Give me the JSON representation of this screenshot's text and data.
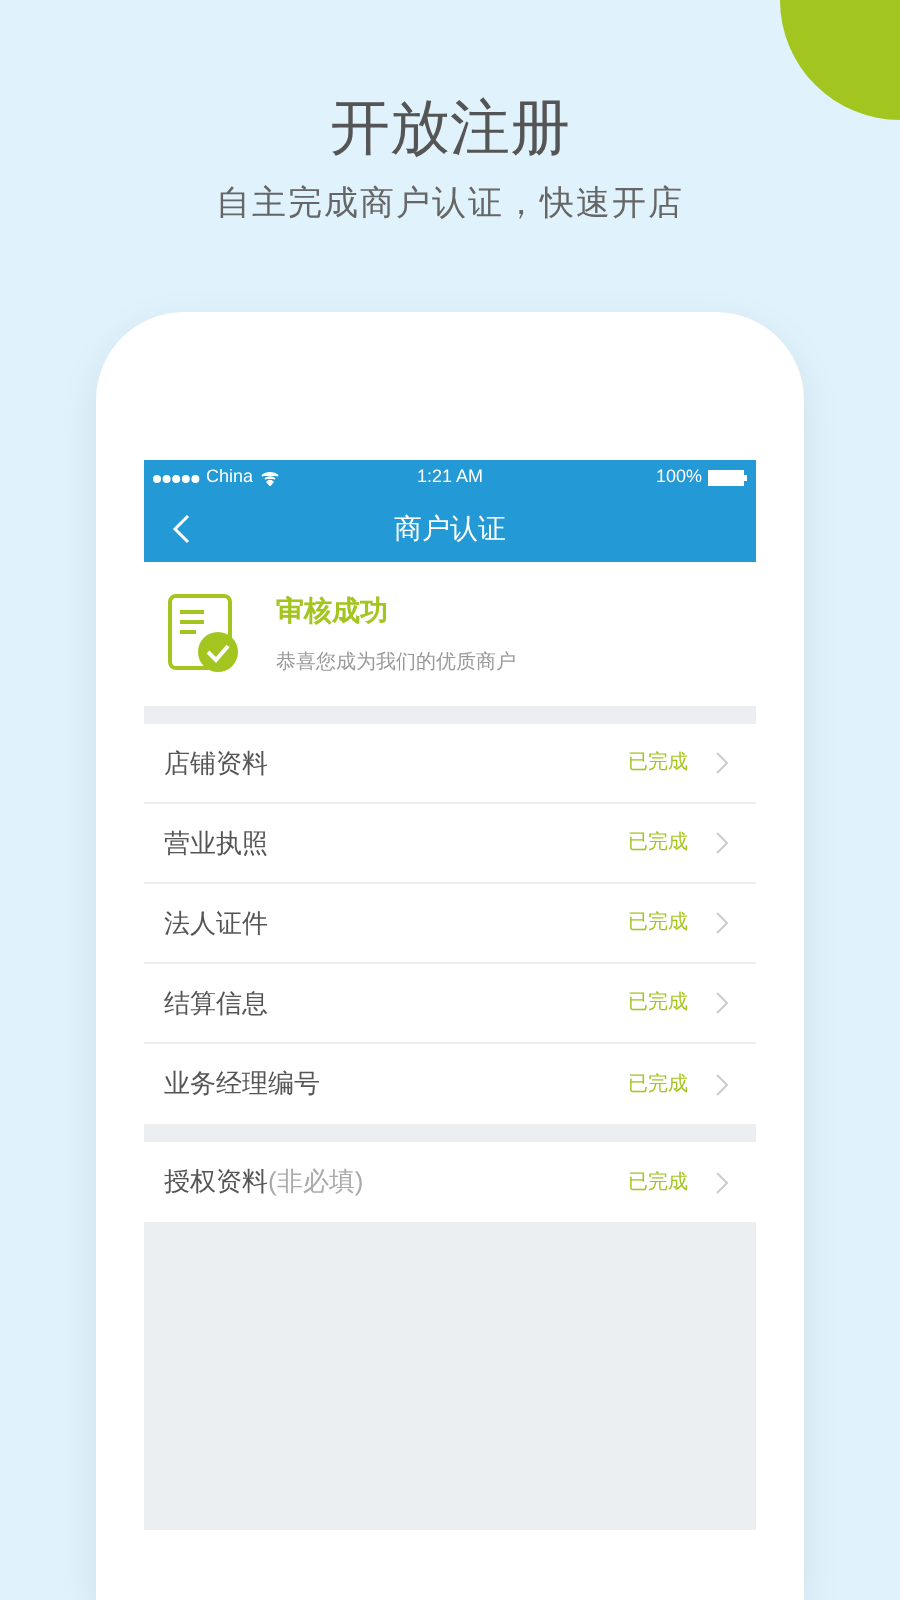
{
  "headline": "开放注册",
  "subtitle": "自主完成商户认证，快速开店",
  "status_bar": {
    "carrier": "China",
    "time": "1:21 AM",
    "battery": "100%"
  },
  "nav": {
    "title": "商户认证"
  },
  "result": {
    "title": "审核成功",
    "message": "恭喜您成为我们的优质商户"
  },
  "groups": [
    [
      {
        "label": "店铺资料",
        "status": "已完成"
      },
      {
        "label": "营业执照",
        "status": "已完成"
      },
      {
        "label": "法人证件",
        "status": "已完成"
      },
      {
        "label": "结算信息",
        "status": "已完成"
      },
      {
        "label": "业务经理编号",
        "status": "已完成"
      }
    ],
    [
      {
        "label": "授权资料",
        "note": "(非必填)",
        "status": "已完成"
      }
    ]
  ]
}
